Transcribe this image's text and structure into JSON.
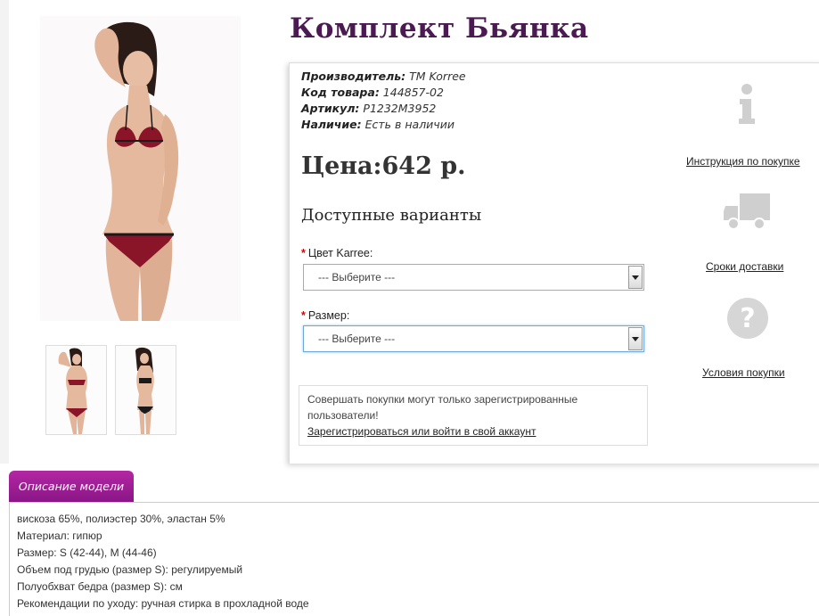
{
  "product": {
    "title": "Комплект Бьянка",
    "specs": [
      {
        "label": "Производитель:",
        "value": "TM Korree"
      },
      {
        "label": "Код товара:",
        "value": "144857-02"
      },
      {
        "label": "Артикул:",
        "value": "P1232M3952"
      },
      {
        "label": "Наличие:",
        "value": "Есть в наличии"
      }
    ],
    "price": "Цена:642 р.",
    "variants_title": "Доступные варианты"
  },
  "options": {
    "color": {
      "required_mark": "*",
      "label": "Цвет Kаrrее:",
      "value": "--- Выберите ---"
    },
    "size": {
      "required_mark": "*",
      "label": "Размер:",
      "value": "--- Выберите ---"
    }
  },
  "notice": {
    "text": "Совершать покупки могут только зарегистрированные пользователи!",
    "link": "Зарегистрироваться или войти в свой аккаунт"
  },
  "side": {
    "instructions": "Инструкция по покупке",
    "delivery": "Сроки доставки",
    "conditions": "Условия покупки"
  },
  "tab": {
    "label": "Описание модели"
  },
  "description": [
    "вискоза 65%, полиэстер 30%, эластан 5%",
    "Материал: гипюр",
    "Размер: S (42-44), M (44-46)",
    "Объем под грудью (размер S): регулируемый",
    "Полуобхват бедра (размер S): см",
    "Рекомендации по уходу: ручная стирка в прохладной воде"
  ],
  "colors": {
    "title": "#4b1a52",
    "tab": "#a01f96",
    "lingerie": "#8b1528"
  }
}
